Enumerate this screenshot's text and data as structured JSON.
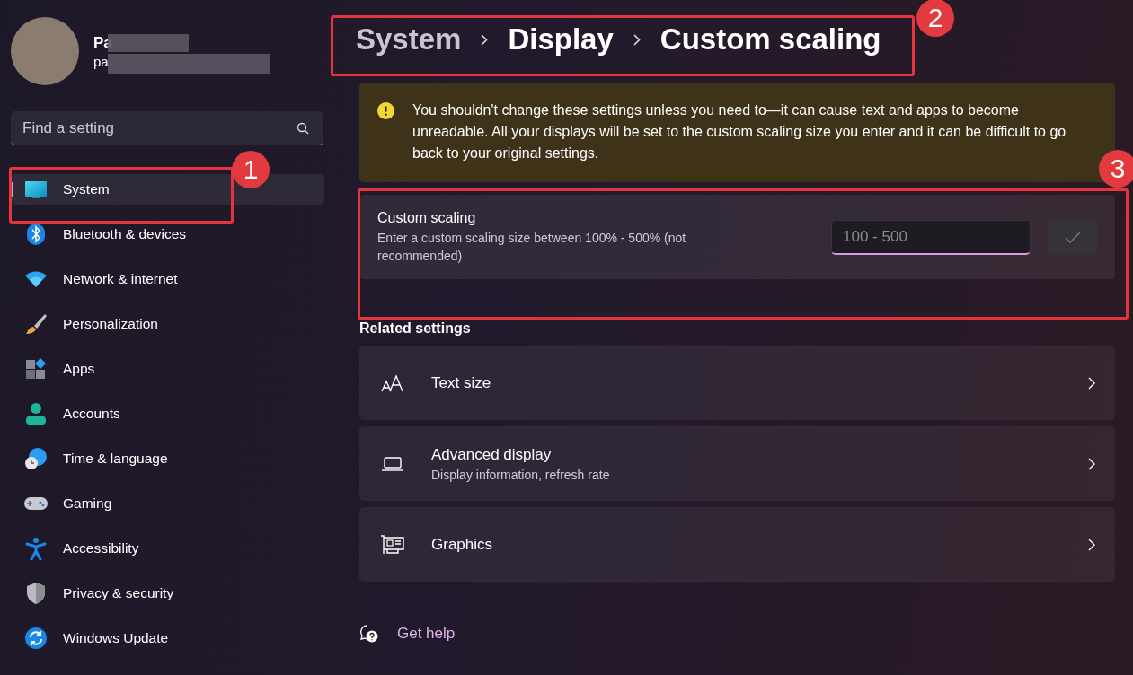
{
  "profile": {
    "name": "Pa",
    "email": "pa"
  },
  "search": {
    "placeholder": "Find a setting"
  },
  "nav": [
    {
      "label": "System",
      "selected": true
    },
    {
      "label": "Bluetooth & devices",
      "selected": false
    },
    {
      "label": "Network & internet",
      "selected": false
    },
    {
      "label": "Personalization",
      "selected": false
    },
    {
      "label": "Apps",
      "selected": false
    },
    {
      "label": "Accounts",
      "selected": false
    },
    {
      "label": "Time & language",
      "selected": false
    },
    {
      "label": "Gaming",
      "selected": false
    },
    {
      "label": "Accessibility",
      "selected": false
    },
    {
      "label": "Privacy & security",
      "selected": false
    },
    {
      "label": "Windows Update",
      "selected": false
    }
  ],
  "breadcrumb": [
    {
      "label": "System",
      "dimmed": true
    },
    {
      "label": "Display",
      "dimmed": false
    },
    {
      "label": "Custom scaling",
      "dimmed": false
    }
  ],
  "warning": {
    "text": "You shouldn't change these settings unless you need to—it can cause text and apps to become unreadable. All your displays will be set to the custom scaling size you enter and it can be difficult to go back to your original settings."
  },
  "custom_scaling": {
    "title": "Custom scaling",
    "description": "Enter a custom scaling size between 100% - 500% (not recommended)",
    "input": {
      "placeholder": "100 - 500"
    },
    "apply_button": {
      "disabled": true
    }
  },
  "related_settings": {
    "heading": "Related settings",
    "items": [
      {
        "title": "Text size"
      },
      {
        "title": "Advanced display",
        "subtitle": "Display information, refresh rate"
      },
      {
        "title": "Graphics"
      }
    ]
  },
  "get_help": "Get help",
  "annotations": [
    {
      "label": "1"
    },
    {
      "label": "2"
    },
    {
      "label": "3"
    }
  ]
}
